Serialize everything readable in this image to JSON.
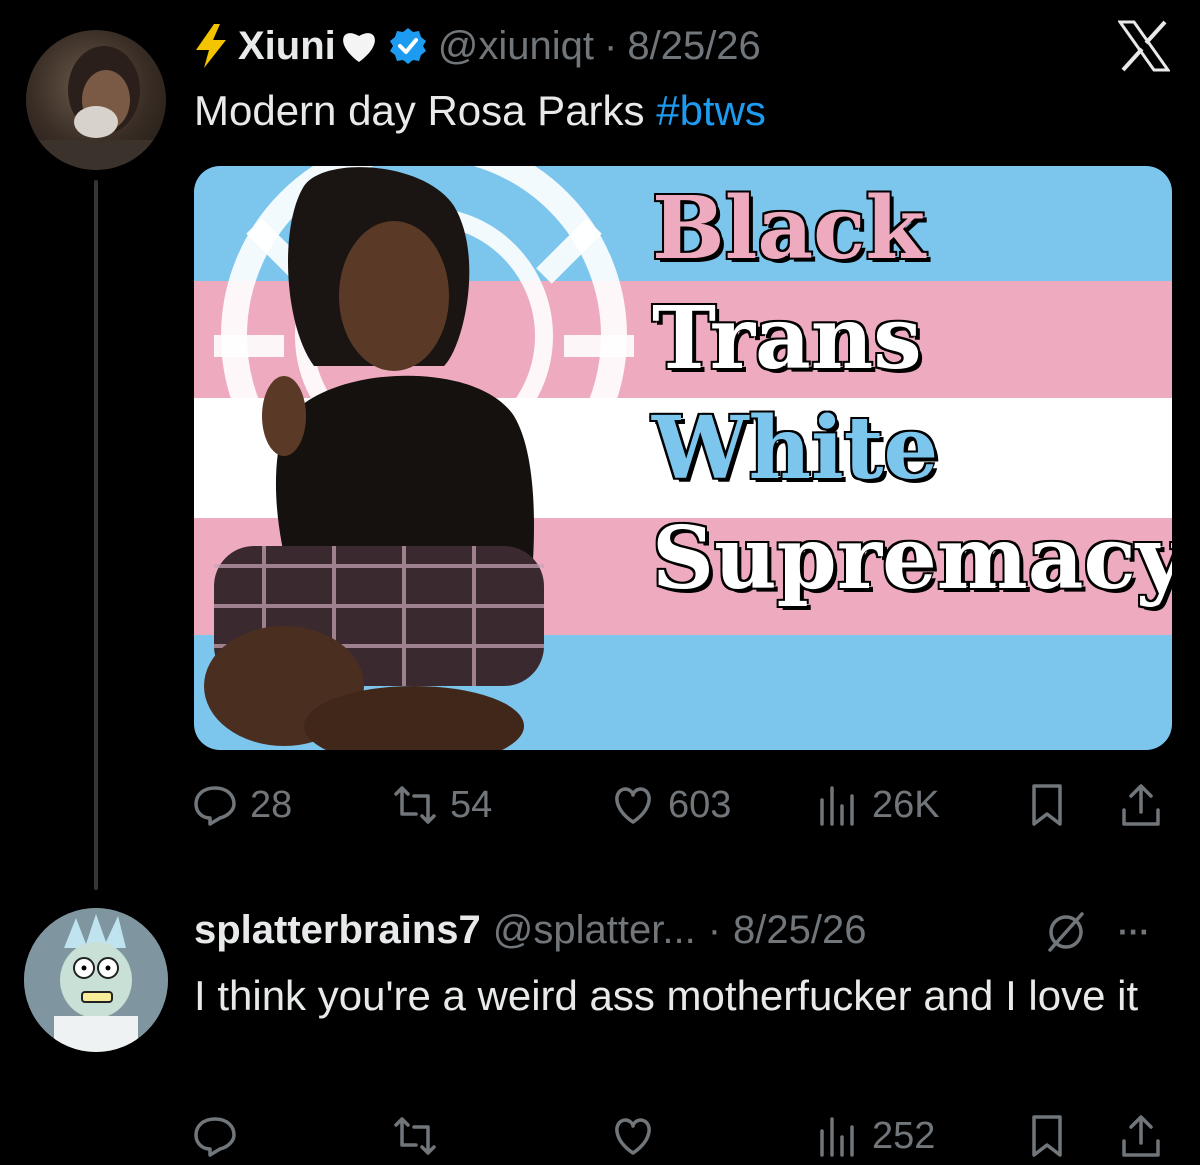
{
  "tweet": {
    "author_name": "Xiuni",
    "name_prefix_icon": "lightning-bolt-icon",
    "name_suffix_icon": "white-heart-icon",
    "handle": "@xiuniqt",
    "separator": "·",
    "date": "8/25/26",
    "text": "Modern day Rosa Parks ",
    "hashtag": "#btws",
    "media": {
      "flag_colors": [
        "#7cc6ee",
        "#eeabbf",
        "#ffffff",
        "#eeabbf",
        "#7cc6ee"
      ],
      "lines": [
        {
          "text": "Black",
          "color": "#eeabbf"
        },
        {
          "text": "Trans",
          "color": "#ffffff"
        },
        {
          "text": "White",
          "color": "#7cc6ee"
        },
        {
          "text": "Supremacy",
          "color": "#ffffff"
        }
      ]
    },
    "stats": {
      "replies": "28",
      "retweets": "54",
      "likes": "603",
      "views": "26K"
    }
  },
  "reply": {
    "author_name": "splatterbrains7",
    "handle": "@splatter...",
    "separator": "·",
    "date": "8/25/26",
    "more_label": "···",
    "text": "I think you're a weird ass motherfucker and I love it",
    "stats": {
      "views": "252"
    }
  },
  "colors": {
    "background": "#000000",
    "text": "#e7e9ea",
    "muted": "#71767b",
    "accent": "#1d9bf0",
    "verified": "#1d9bf0"
  }
}
